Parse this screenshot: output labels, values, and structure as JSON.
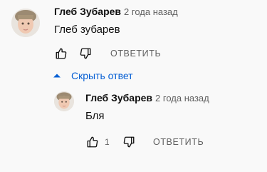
{
  "comment": {
    "author": "Глеб Зубарев",
    "time": "2 года назад",
    "text": "Глеб зубарев",
    "reply_label": "ОТВЕТИТЬ"
  },
  "replies_toggle": {
    "label": "Скрыть ответ",
    "icon": "chevron-up-icon"
  },
  "reply": {
    "author": "Глеб Зубарев",
    "time": "2 года назад",
    "text": "Бля",
    "likes": "1",
    "reply_label": "ОТВЕТИТЬ"
  },
  "colors": {
    "link": "#065fd4",
    "secondary_text": "#606060",
    "background": "#f9f9f9"
  }
}
